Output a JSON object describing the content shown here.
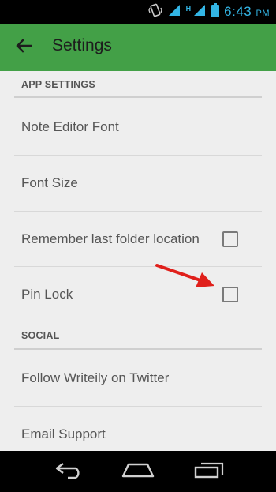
{
  "status_bar": {
    "time": "6:43",
    "ampm": "PM",
    "network_label": "H"
  },
  "app_bar": {
    "title": "Settings",
    "accent": "#43a047"
  },
  "sections": {
    "app_settings": {
      "header": "APP SETTINGS",
      "items": {
        "note_editor_font": "Note Editor Font",
        "font_size": "Font Size",
        "remember_last_folder": "Remember last folder location",
        "pin_lock": "Pin Lock"
      },
      "checkboxes": {
        "remember_last_folder": false,
        "pin_lock": false
      }
    },
    "social": {
      "header": "SOCIAL",
      "items": {
        "follow_twitter": "Follow Writeily on Twitter",
        "email_support": "Email Support"
      }
    }
  },
  "annotation": {
    "arrow_color": "#e0201b"
  },
  "icons": [
    "back-arrow-icon",
    "vibrate-icon",
    "signal-icon",
    "battery-icon",
    "back-nav-icon",
    "home-nav-icon",
    "recents-nav-icon"
  ]
}
